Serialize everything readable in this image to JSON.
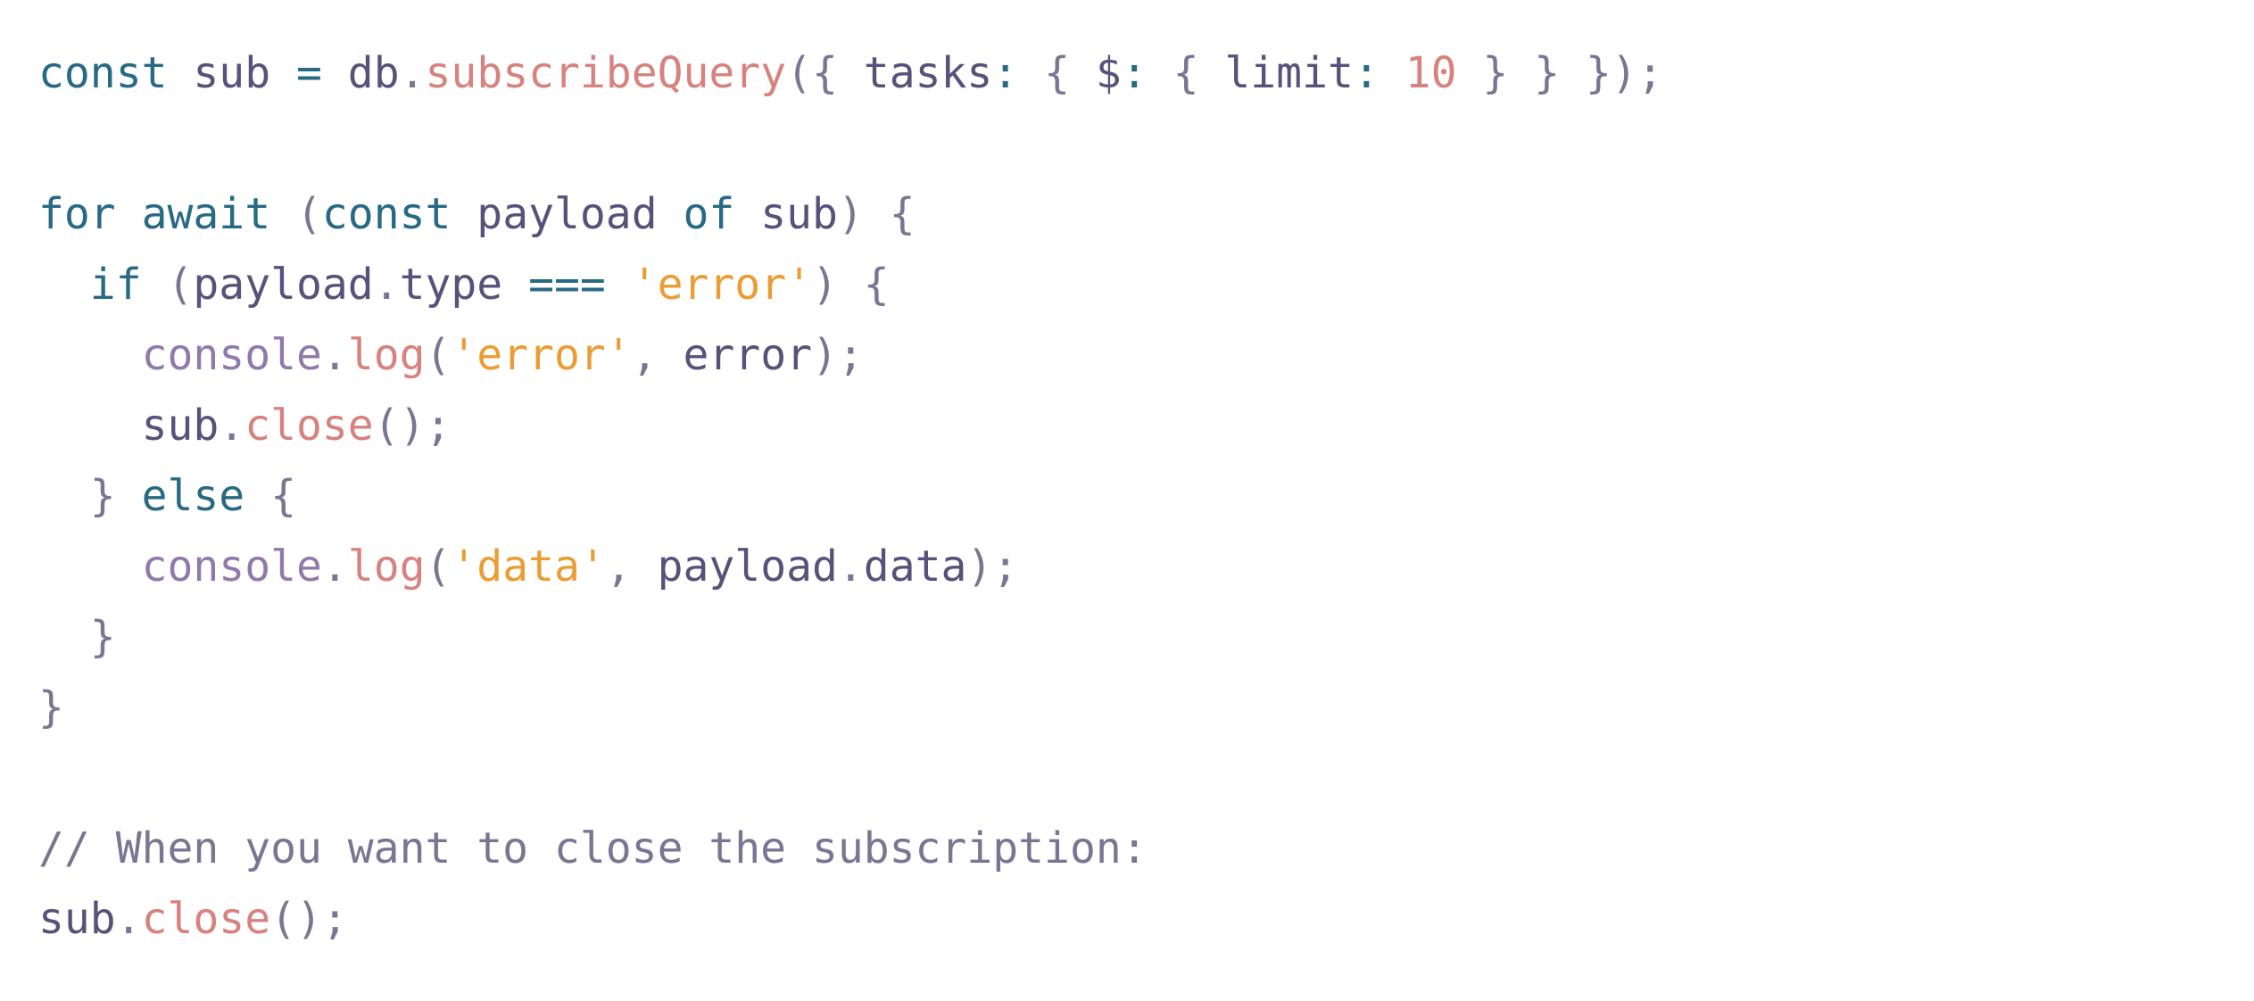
{
  "palette": {
    "keyword": "#286983",
    "text": "#575279",
    "function": "#d7827e",
    "string": "#ea9d34",
    "number": "#d7827e",
    "punctuation": "#797593",
    "object": "#907aa9",
    "comment": "#797593"
  },
  "code": {
    "lines": [
      {
        "tokens": [
          {
            "text": "const",
            "kind": "keyword"
          },
          {
            "text": " sub ",
            "kind": "text"
          },
          {
            "text": "=",
            "kind": "keyword"
          },
          {
            "text": " db",
            "kind": "text"
          },
          {
            "text": ".",
            "kind": "punctuation"
          },
          {
            "text": "subscribeQuery",
            "kind": "function"
          },
          {
            "text": "({",
            "kind": "punctuation"
          },
          {
            "text": " tasks",
            "kind": "text"
          },
          {
            "text": ":",
            "kind": "keyword"
          },
          {
            "text": " {",
            "kind": "punctuation"
          },
          {
            "text": " $",
            "kind": "text"
          },
          {
            "text": ":",
            "kind": "keyword"
          },
          {
            "text": " {",
            "kind": "punctuation"
          },
          {
            "text": " limit",
            "kind": "text"
          },
          {
            "text": ":",
            "kind": "keyword"
          },
          {
            "text": " ",
            "kind": "text"
          },
          {
            "text": "10",
            "kind": "number"
          },
          {
            "text": " } } });",
            "kind": "punctuation"
          }
        ]
      },
      {
        "tokens": []
      },
      {
        "tokens": [
          {
            "text": "for",
            "kind": "keyword"
          },
          {
            "text": " ",
            "kind": "text"
          },
          {
            "text": "await",
            "kind": "keyword"
          },
          {
            "text": " (",
            "kind": "punctuation"
          },
          {
            "text": "const",
            "kind": "keyword"
          },
          {
            "text": " payload ",
            "kind": "text"
          },
          {
            "text": "of",
            "kind": "keyword"
          },
          {
            "text": " sub",
            "kind": "text"
          },
          {
            "text": ") {",
            "kind": "punctuation"
          }
        ]
      },
      {
        "tokens": [
          {
            "text": "  ",
            "kind": "text"
          },
          {
            "text": "if",
            "kind": "keyword"
          },
          {
            "text": " (",
            "kind": "punctuation"
          },
          {
            "text": "payload",
            "kind": "text"
          },
          {
            "text": ".",
            "kind": "punctuation"
          },
          {
            "text": "type ",
            "kind": "text"
          },
          {
            "text": "===",
            "kind": "keyword"
          },
          {
            "text": " ",
            "kind": "text"
          },
          {
            "text": "'error'",
            "kind": "string"
          },
          {
            "text": ") {",
            "kind": "punctuation"
          }
        ]
      },
      {
        "tokens": [
          {
            "text": "    ",
            "kind": "text"
          },
          {
            "text": "console",
            "kind": "object"
          },
          {
            "text": ".",
            "kind": "punctuation"
          },
          {
            "text": "log",
            "kind": "function"
          },
          {
            "text": "(",
            "kind": "punctuation"
          },
          {
            "text": "'error'",
            "kind": "string"
          },
          {
            "text": ",",
            "kind": "punctuation"
          },
          {
            "text": " error",
            "kind": "text"
          },
          {
            "text": ");",
            "kind": "punctuation"
          }
        ]
      },
      {
        "tokens": [
          {
            "text": "    sub",
            "kind": "text"
          },
          {
            "text": ".",
            "kind": "punctuation"
          },
          {
            "text": "close",
            "kind": "function"
          },
          {
            "text": "();",
            "kind": "punctuation"
          }
        ]
      },
      {
        "tokens": [
          {
            "text": "  }",
            "kind": "punctuation"
          },
          {
            "text": " ",
            "kind": "text"
          },
          {
            "text": "else",
            "kind": "keyword"
          },
          {
            "text": " {",
            "kind": "punctuation"
          }
        ]
      },
      {
        "tokens": [
          {
            "text": "    ",
            "kind": "text"
          },
          {
            "text": "console",
            "kind": "object"
          },
          {
            "text": ".",
            "kind": "punctuation"
          },
          {
            "text": "log",
            "kind": "function"
          },
          {
            "text": "(",
            "kind": "punctuation"
          },
          {
            "text": "'data'",
            "kind": "string"
          },
          {
            "text": ",",
            "kind": "punctuation"
          },
          {
            "text": " payload",
            "kind": "text"
          },
          {
            "text": ".",
            "kind": "punctuation"
          },
          {
            "text": "data",
            "kind": "text"
          },
          {
            "text": ");",
            "kind": "punctuation"
          }
        ]
      },
      {
        "tokens": [
          {
            "text": "  }",
            "kind": "punctuation"
          }
        ]
      },
      {
        "tokens": [
          {
            "text": "}",
            "kind": "punctuation"
          }
        ]
      },
      {
        "tokens": []
      },
      {
        "tokens": [
          {
            "text": "// When you want to close the subscription:",
            "kind": "comment"
          }
        ]
      },
      {
        "tokens": [
          {
            "text": "sub",
            "kind": "text"
          },
          {
            "text": ".",
            "kind": "punctuation"
          },
          {
            "text": "close",
            "kind": "function"
          },
          {
            "text": "();",
            "kind": "punctuation"
          }
        ]
      }
    ]
  }
}
